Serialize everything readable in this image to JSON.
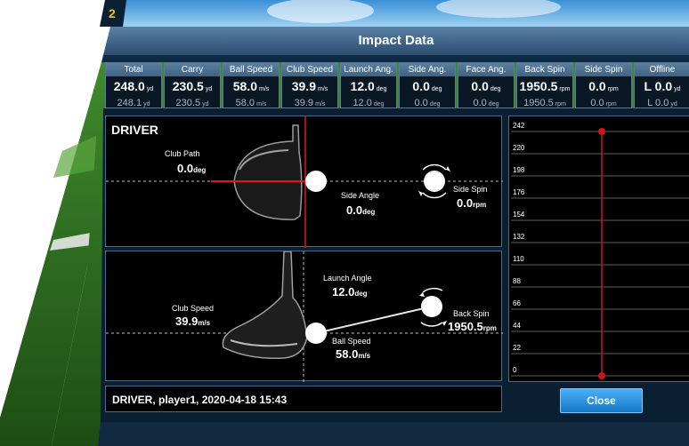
{
  "window_title": "Impact Data",
  "corner_tag": "2",
  "colors": {
    "accent": "#d0121b",
    "panel_bg": "#000000",
    "header_blue": "#3e6384",
    "close_button": "#1e8fe0"
  },
  "stats": [
    {
      "label": "Total",
      "value": "248.0",
      "unit": "yd",
      "avg": "248.1",
      "avg_unit": "yd"
    },
    {
      "label": "Carry",
      "value": "230.5",
      "unit": "yd",
      "avg": "230.5",
      "avg_unit": "yd"
    },
    {
      "label": "Ball Speed",
      "value": "58.0",
      "unit": "m/s",
      "avg": "58.0",
      "avg_unit": "m/s"
    },
    {
      "label": "Club Speed",
      "value": "39.9",
      "unit": "m/s",
      "avg": "39.9",
      "avg_unit": "m/s"
    },
    {
      "label": "Launch Ang.",
      "value": "12.0",
      "unit": "deg",
      "avg": "12.0",
      "avg_unit": "deg"
    },
    {
      "label": "Side Ang.",
      "value": "0.0",
      "unit": "deg",
      "avg": "0.0",
      "avg_unit": "deg"
    },
    {
      "label": "Face Ang.",
      "value": "0.0",
      "unit": "deg",
      "avg": "0.0",
      "avg_unit": "deg"
    },
    {
      "label": "Back Spin",
      "value": "1950.5",
      "unit": "rpm",
      "avg": "1950.5",
      "avg_unit": "rpm"
    },
    {
      "label": "Side Spin",
      "value": "0.0",
      "unit": "rpm",
      "avg": "0.0",
      "avg_unit": "rpm"
    },
    {
      "label": "Offline",
      "value": "L 0.0",
      "unit": "yd",
      "avg": "L 0.0",
      "avg_unit": "yd"
    }
  ],
  "top_view": {
    "club_name": "DRIVER",
    "club_path_label": "Club Path",
    "club_path_value": "0.0",
    "club_path_unit": "deg",
    "side_angle_label": "Side Angle",
    "side_angle_value": "0.0",
    "side_angle_unit": "deg",
    "side_spin_label": "Side Spin",
    "side_spin_value": "0.0",
    "side_spin_unit": "rpm"
  },
  "side_view": {
    "launch_angle_label": "Launch Angle",
    "launch_angle_value": "12.0",
    "launch_angle_unit": "deg",
    "club_speed_label": "Club Speed",
    "club_speed_value": "39.9",
    "club_speed_unit": "m/s",
    "back_spin_label": "Back Spin",
    "back_spin_value": "1950.5",
    "back_spin_unit": "rpm",
    "ball_speed_label": "Ball Speed",
    "ball_speed_value": "58.0",
    "ball_speed_unit": "m/s"
  },
  "footer": {
    "shot_info": "DRIVER, player1, 2020-04-18 15:43"
  },
  "close_label": "Close",
  "chart_data": {
    "type": "scatter",
    "y_ticks": [
      "242",
      "220",
      "198",
      "176",
      "154",
      "132",
      "110",
      "88",
      "66",
      "44",
      "22",
      "0"
    ],
    "ylim": [
      0,
      242
    ],
    "points": [
      {
        "x": 0,
        "y": 242
      },
      {
        "x": 0,
        "y": 0
      }
    ]
  }
}
